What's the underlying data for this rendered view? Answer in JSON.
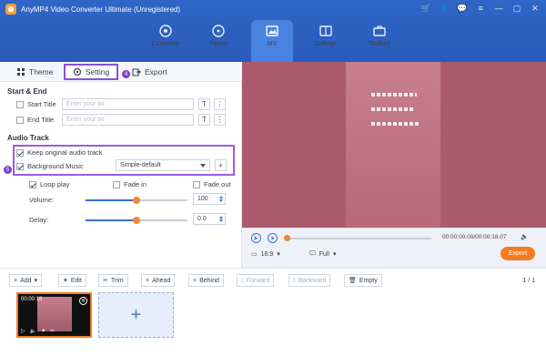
{
  "app": {
    "title": "AnyMP4 Video Converter Ultimate (Unregistered)"
  },
  "nav": {
    "items": [
      {
        "label": "Converter",
        "icon": "converter-icon"
      },
      {
        "label": "Ripper",
        "icon": "ripper-icon"
      },
      {
        "label": "MV",
        "icon": "mv-icon",
        "active": true
      },
      {
        "label": "Collage",
        "icon": "collage-icon"
      },
      {
        "label": "Toolbox",
        "icon": "toolbox-icon"
      }
    ]
  },
  "tabs": {
    "theme": "Theme",
    "setting": "Setting",
    "export": "Export",
    "setting_badge": "4"
  },
  "start_end": {
    "title": "Start & End",
    "start_title_label": "Start Title",
    "start_title_placeholder": "Enter your txt",
    "end_title_label": "End Title",
    "end_title_placeholder": "Enter your txt"
  },
  "audio_track": {
    "title": "Audio Track",
    "keep_original": "Keep original audio track",
    "background_music": "Background Music",
    "music_select": "Simple-default",
    "add_button": "+",
    "badge": "5",
    "loop_play": "Loop play",
    "fade_in": "Fade in",
    "fade_out": "Fade out",
    "volume_label": "Volume:",
    "volume_value": "100",
    "volume_level": 0.5,
    "delay_label": "Delay:",
    "delay_value": "0.0",
    "delay_level": 0.5
  },
  "player": {
    "timecode": "00:00:00.00/00:00:18.07",
    "aspect_ratio": "16:9",
    "zoom": "Full",
    "export_button": "Export",
    "progress": 0.0
  },
  "toolbar": {
    "add": "Add",
    "edit": "Edit",
    "trim": "Trim",
    "ahead": "Ahead",
    "behind": "Behind",
    "forward": "Forward",
    "backward": "Backward",
    "empty": "Empty",
    "page": "1 / 1"
  },
  "timeline": {
    "clip_duration": "00:00:18",
    "add_symbol": "+"
  },
  "colors": {
    "brand_blue": "#2f66c7",
    "accent_orange": "#f47b20",
    "highlight_purple": "#9b5be6"
  }
}
